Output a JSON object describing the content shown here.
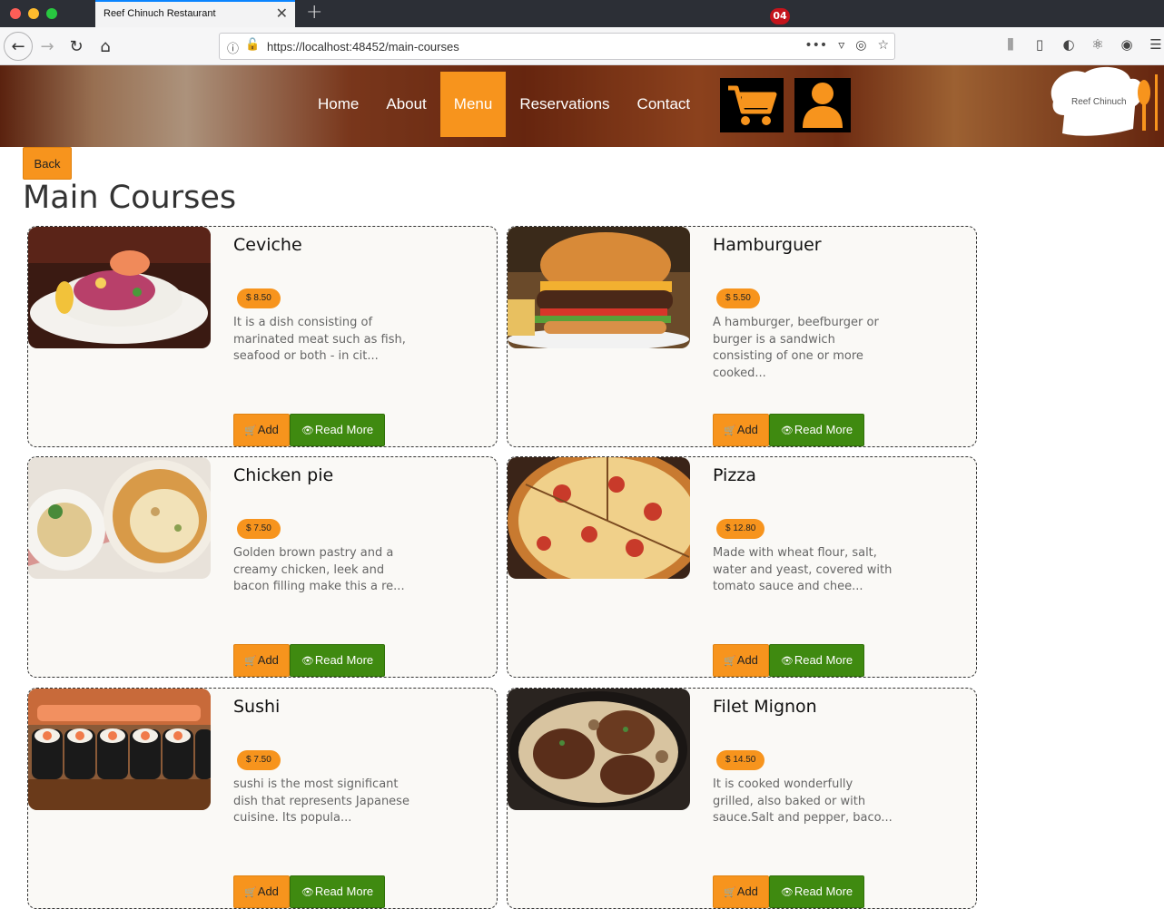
{
  "browser": {
    "tab_title": "Reef Chinuch Restaurant",
    "url": "https://localhost:48452/main-courses"
  },
  "header": {
    "nav": [
      "Home",
      "About",
      "Menu",
      "Reservations",
      "Contact"
    ],
    "active_nav": "Menu",
    "cart_count": "04",
    "logo_text": "Reef Chinuch"
  },
  "page": {
    "back_label": "Back",
    "title": "Main Courses",
    "add_label": "Add",
    "read_more_label": "Read More"
  },
  "dishes": [
    {
      "name": "Ceviche",
      "price": "$ 8.50",
      "desc": "It is a dish consisting of marinated meat such as fish, seafood or both - in cit..."
    },
    {
      "name": "Hamburguer",
      "price": "$ 5.50",
      "desc": "A hamburger, beefburger or burger is a sandwich consisting of one or more cooked..."
    },
    {
      "name": "Chicken pie",
      "price": "$ 7.50",
      "desc": "Golden brown pastry and a creamy chicken, leek and bacon filling make this a re..."
    },
    {
      "name": "Pizza",
      "price": "$ 12.80",
      "desc": "Made with wheat flour, salt, water and yeast, covered with tomato sauce and chee..."
    },
    {
      "name": "Sushi",
      "price": "$ 7.50",
      "desc": "sushi is the most significant dish that represents Japanese cuisine. Its popula..."
    },
    {
      "name": "Filet Mignon",
      "price": "$ 14.50",
      "desc": "It is cooked wonderfully grilled, also baked or with sauce.Salt and pepper, baco..."
    }
  ]
}
